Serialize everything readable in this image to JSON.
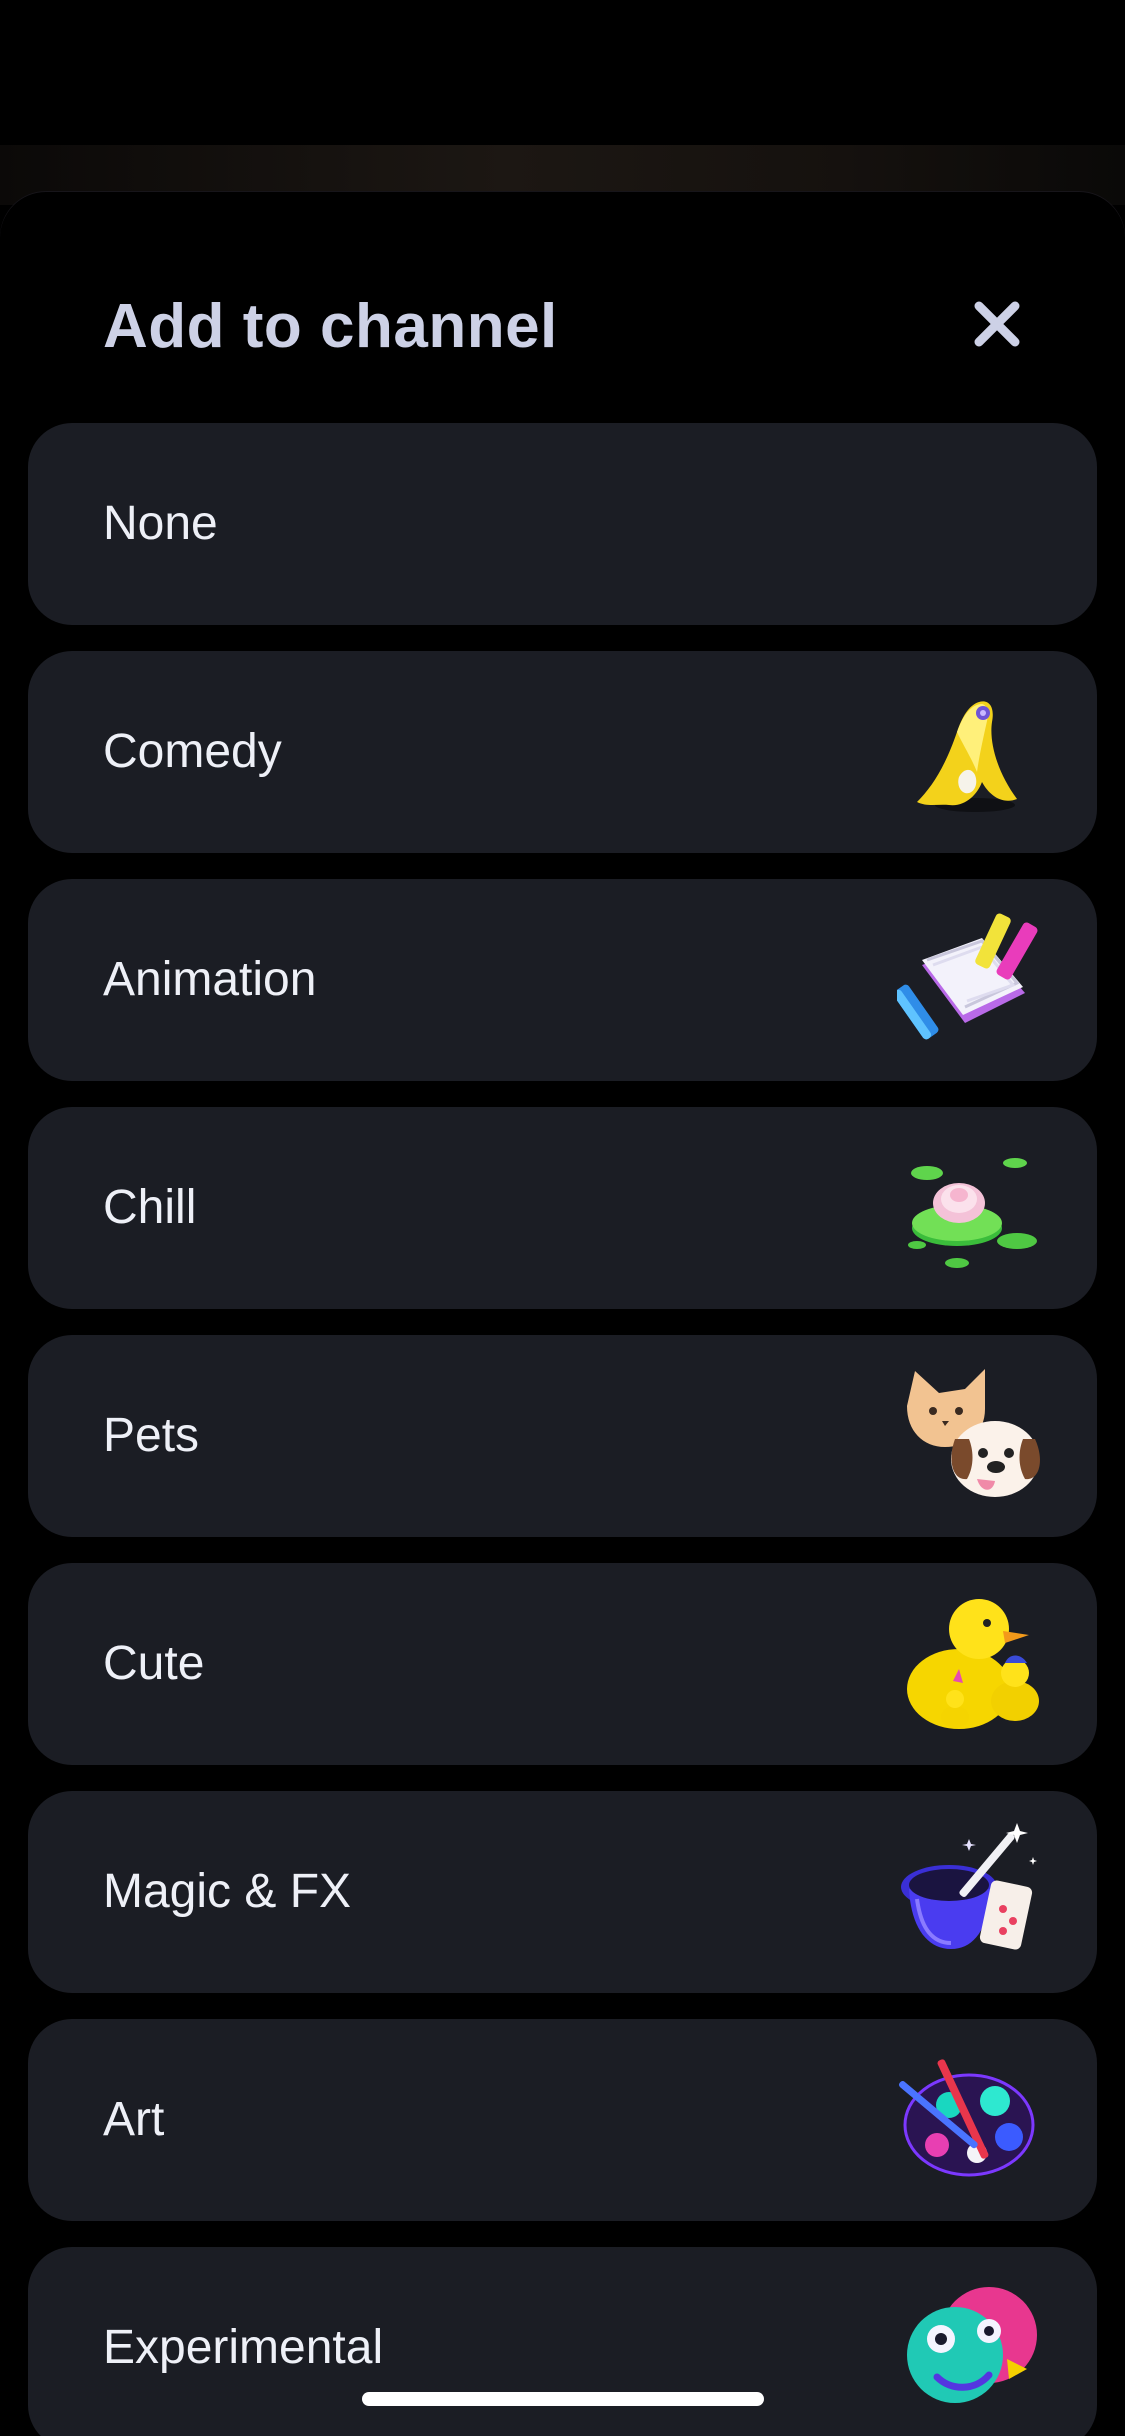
{
  "sheet": {
    "title": "Add to channel",
    "close_icon": "close-icon"
  },
  "channels": [
    {
      "label": "None",
      "icon": ""
    },
    {
      "label": "Comedy",
      "icon": "banana-peel-icon"
    },
    {
      "label": "Animation",
      "icon": "flipbook-pencils-icon"
    },
    {
      "label": "Chill",
      "icon": "lotus-lily-pad-icon"
    },
    {
      "label": "Pets",
      "icon": "cat-dog-icon"
    },
    {
      "label": "Cute",
      "icon": "rubber-ducks-icon"
    },
    {
      "label": "Magic & FX",
      "icon": "magic-hat-wand-icon"
    },
    {
      "label": "Art",
      "icon": "paint-palette-icon"
    },
    {
      "label": "Experimental",
      "icon": "abstract-faces-icon"
    }
  ],
  "colors": {
    "background": "#000000",
    "row_background": "#1b1d24",
    "title_text": "#cdd1e6",
    "row_text": "#eef0f7"
  }
}
